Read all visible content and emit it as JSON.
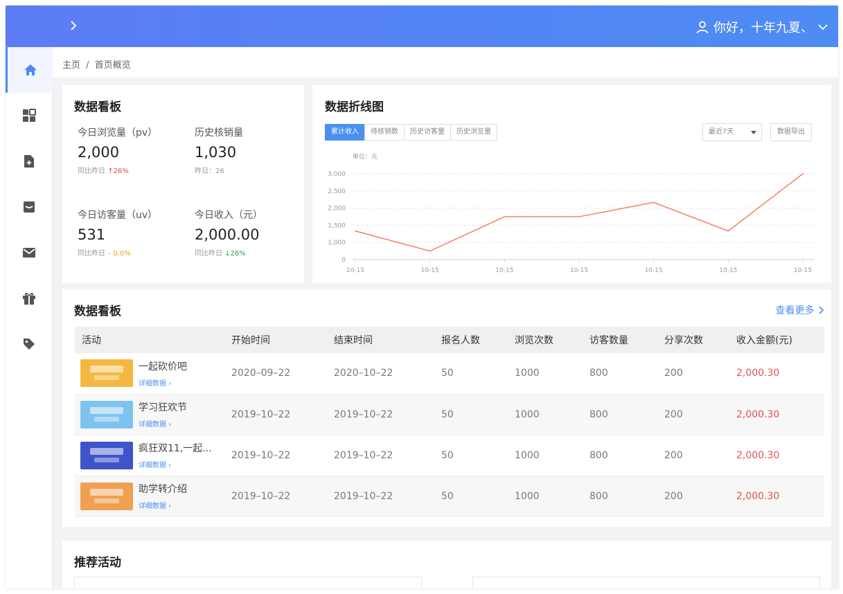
{
  "topbar": {
    "user_greeting": "你好，十年九夏、"
  },
  "breadcrumb": {
    "home": "主页",
    "separator": "/",
    "current": "首页概览"
  },
  "sidebar": {
    "items": [
      {
        "icon": "home-icon",
        "active": true
      },
      {
        "icon": "grid-icon",
        "active": false
      },
      {
        "icon": "document-add-icon",
        "active": false
      },
      {
        "icon": "inbox-icon",
        "active": false
      },
      {
        "icon": "mail-icon",
        "active": false
      },
      {
        "icon": "gift-icon",
        "active": false
      },
      {
        "icon": "tag-icon",
        "active": false
      }
    ]
  },
  "dashboard": {
    "title": "数据看板",
    "stats": [
      {
        "label": "今日浏览量（pv）",
        "value": "2,000",
        "sub_prefix": "同比昨日",
        "sub_value": "↑26%",
        "trend": "up-red"
      },
      {
        "label": "历史核销量",
        "value": "1,030",
        "sub_prefix": "昨日：26",
        "sub_value": "",
        "trend": "none"
      },
      {
        "label": "今日访客量（uv）",
        "value": "531",
        "sub_prefix": "同比昨日",
        "sub_value": "– 0.0%",
        "trend": "flat-orange"
      },
      {
        "label": "今日收入（元）",
        "value": "2,000.00",
        "sub_prefix": "同比昨日",
        "sub_value": "↓26%",
        "trend": "up-green"
      }
    ]
  },
  "linechart": {
    "title": "数据折线图",
    "tabs": [
      "累计收入",
      "待核销数",
      "历史访客量",
      "历史浏览量"
    ],
    "active_tab": 0,
    "range_select": "最近7天",
    "export_label": "数据导出",
    "unit_label": "单位：元"
  },
  "chart_data": {
    "type": "line",
    "x": [
      "10-15",
      "10-15",
      "10-15",
      "10-15",
      "10-15",
      "10-15",
      "10-15"
    ],
    "series": [
      {
        "values": [
          1000,
          300,
          1500,
          1500,
          2000,
          1000,
          3000
        ]
      }
    ],
    "yticks": [
      "3,000",
      "2,500",
      "2,000",
      "1,500",
      "1,000",
      "0"
    ],
    "ylim": [
      0,
      3000
    ],
    "grid": true,
    "line_color": "#f08a6a"
  },
  "activities": {
    "title": "数据看板",
    "more_label": "查看更多",
    "columns": [
      "活动",
      "开始时间",
      "结束时间",
      "报名人数",
      "浏览次数",
      "访客数量",
      "分享次数",
      "收入金额(元)"
    ],
    "detail_label": "详细数据",
    "rows": [
      {
        "name": "一起砍价吧",
        "start": "2020–09–22",
        "end": "2020–10–22",
        "signups": "50",
        "views": "1000",
        "visitors": "800",
        "shares": "200",
        "income": "2,000.30",
        "thumb_color": "#f4b842"
      },
      {
        "name": "学习狂欢节",
        "start": "2019–10–22",
        "end": "2019–10–22",
        "signups": "50",
        "views": "1000",
        "visitors": "800",
        "shares": "200",
        "income": "2,000.30",
        "thumb_color": "#7ec3ee"
      },
      {
        "name": "疯狂双11,一起...",
        "start": "2019–10–22",
        "end": "2019–10–22",
        "signups": "50",
        "views": "1000",
        "visitors": "800",
        "shares": "200",
        "income": "2,000.30",
        "thumb_color": "#3e54c8"
      },
      {
        "name": "助学转介绍",
        "start": "2019–10–22",
        "end": "2019–10–22",
        "signups": "50",
        "views": "1000",
        "visitors": "800",
        "shares": "200",
        "income": "2,000.30",
        "thumb_color": "#f0a050"
      }
    ]
  },
  "recommend": {
    "title": "推荐活动"
  }
}
